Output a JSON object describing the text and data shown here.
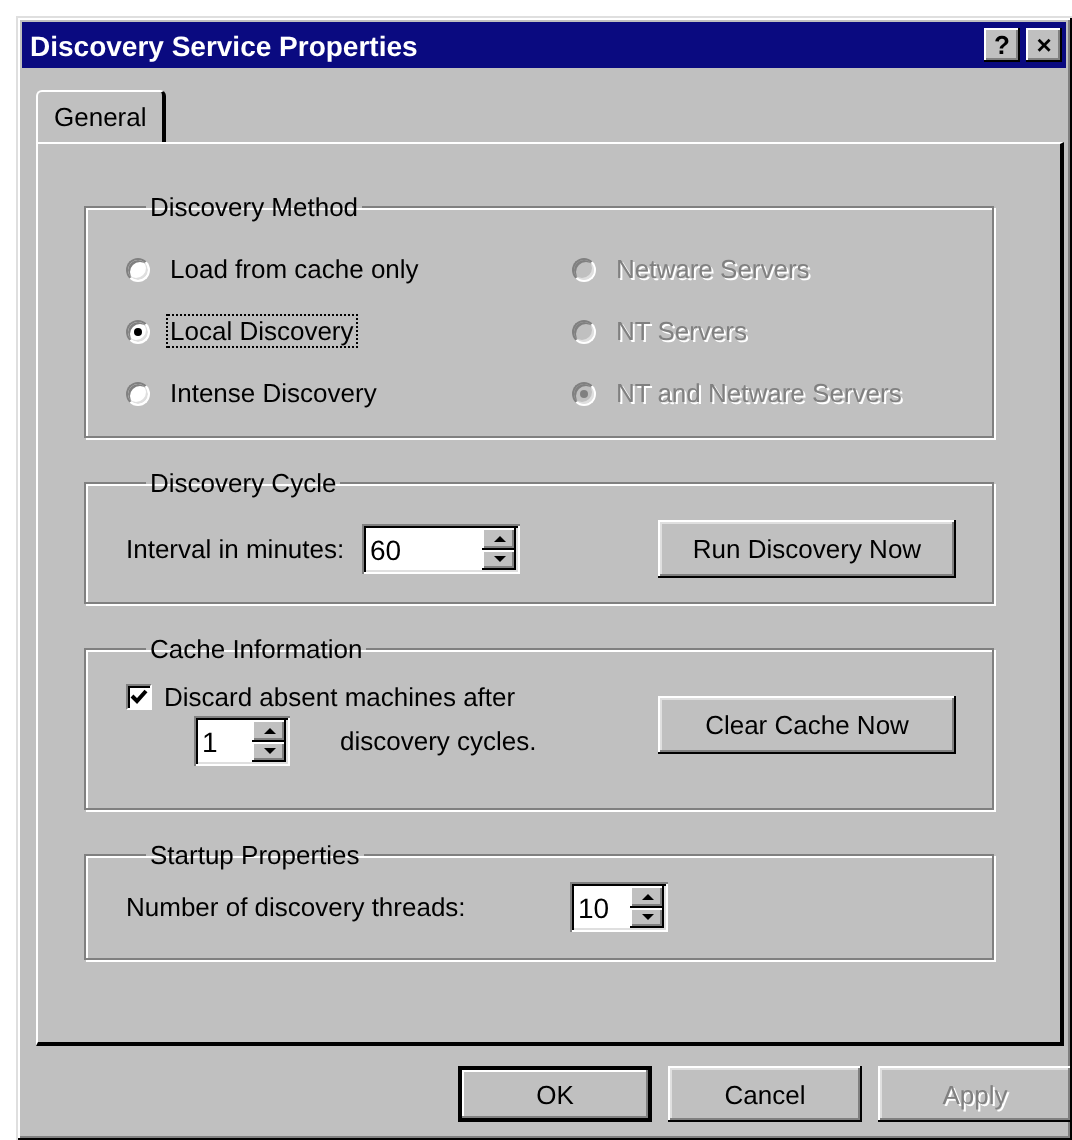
{
  "window": {
    "title": "Discovery Service Properties",
    "help_button": "?",
    "close_button": "×"
  },
  "tabs": [
    {
      "label": "General",
      "selected": true
    }
  ],
  "discovery_method": {
    "title": "Discovery Method",
    "options": [
      {
        "label": "Load from cache only",
        "selected": false,
        "disabled": false,
        "focused": false
      },
      {
        "label": "Local Discovery",
        "selected": true,
        "disabled": false,
        "focused": true
      },
      {
        "label": "Intense Discovery",
        "selected": false,
        "disabled": false,
        "focused": false
      },
      {
        "label": "Netware Servers",
        "selected": false,
        "disabled": true,
        "focused": false
      },
      {
        "label": "NT Servers",
        "selected": false,
        "disabled": true,
        "focused": false
      },
      {
        "label": "NT and Netware Servers",
        "selected": true,
        "disabled": true,
        "focused": false
      }
    ]
  },
  "discovery_cycle": {
    "title": "Discovery Cycle",
    "interval_label": "Interval in minutes:",
    "interval_value": "60",
    "run_button": "Run Discovery Now"
  },
  "cache_information": {
    "title": "Cache Information",
    "discard_checkbox": {
      "label": "Discard absent machines after",
      "checked": true
    },
    "cycles_value": "1",
    "cycles_label": "discovery cycles.",
    "clear_button": "Clear Cache Now"
  },
  "startup_properties": {
    "title": "Startup Properties",
    "threads_label": "Number of discovery threads:",
    "threads_value": "10"
  },
  "buttons": [
    {
      "label": "OK",
      "default": true,
      "disabled": false
    },
    {
      "label": "Cancel",
      "default": false,
      "disabled": false
    },
    {
      "label": "Apply",
      "default": false,
      "disabled": true
    }
  ]
}
